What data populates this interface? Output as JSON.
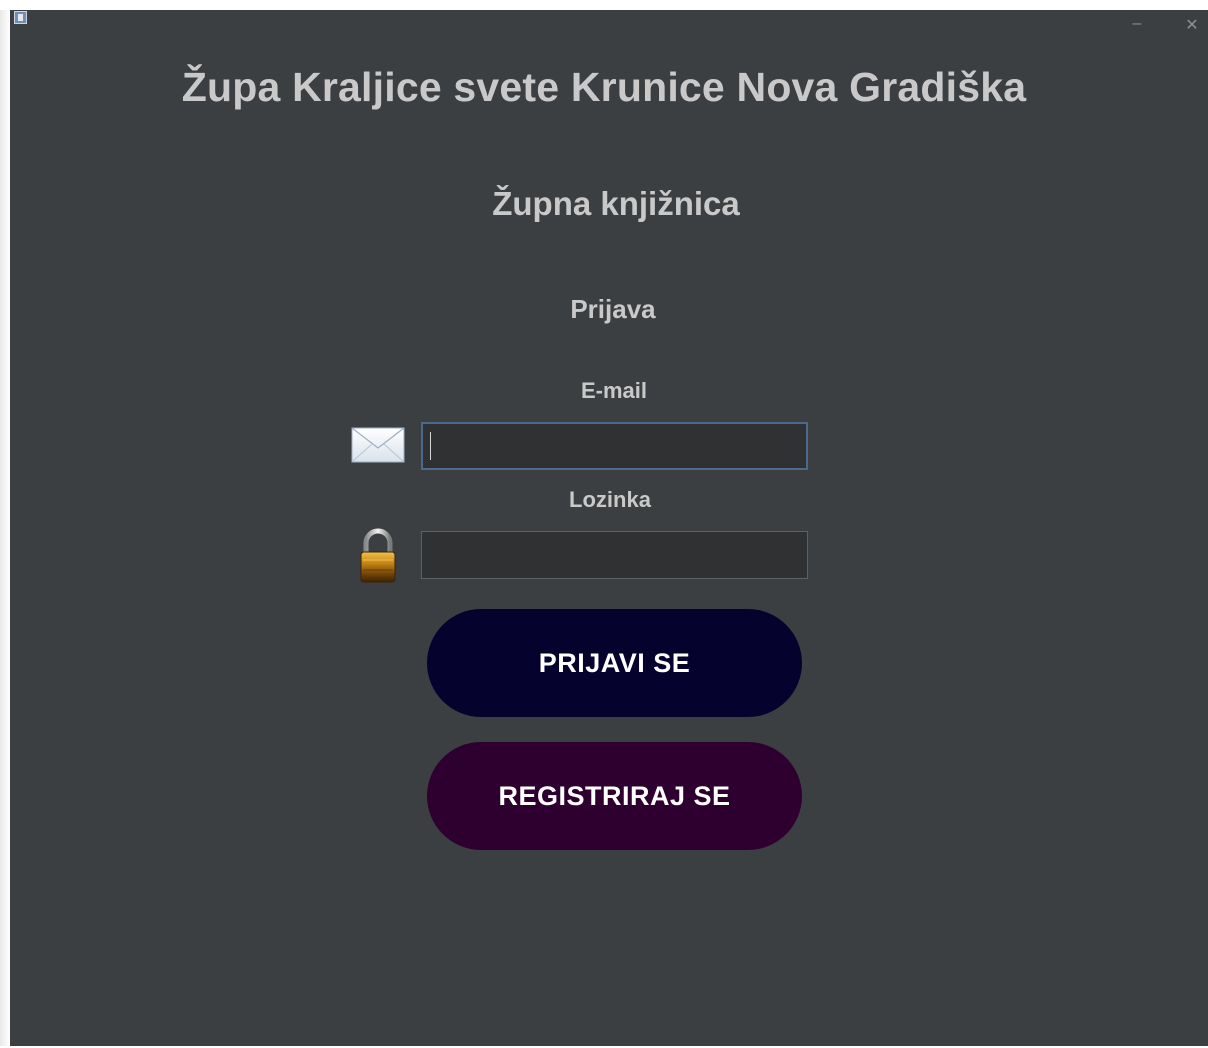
{
  "window": {
    "app_icon": "java-app-icon",
    "minimize_glyph": "–",
    "close_glyph": "✕"
  },
  "header": {
    "title": "Župa Kraljice svete Krunice Nova Gradiška",
    "subtitle": "Župna knjižnica"
  },
  "login": {
    "section_title": "Prijava",
    "email_label": "E-mail",
    "email_value": "",
    "email_icon": "envelope-icon",
    "password_label": "Lozinka",
    "password_value": "",
    "password_icon": "padlock-icon",
    "login_button": "PRIJAVI SE",
    "register_button": "REGISTRIRAJ SE"
  },
  "colors": {
    "background": "#3c3f41",
    "text": "#c9c9c9",
    "login_button": "#05022e",
    "register_button": "#2d0030",
    "input_background": "#2f3133",
    "focus_border": "#4a6a8d"
  }
}
